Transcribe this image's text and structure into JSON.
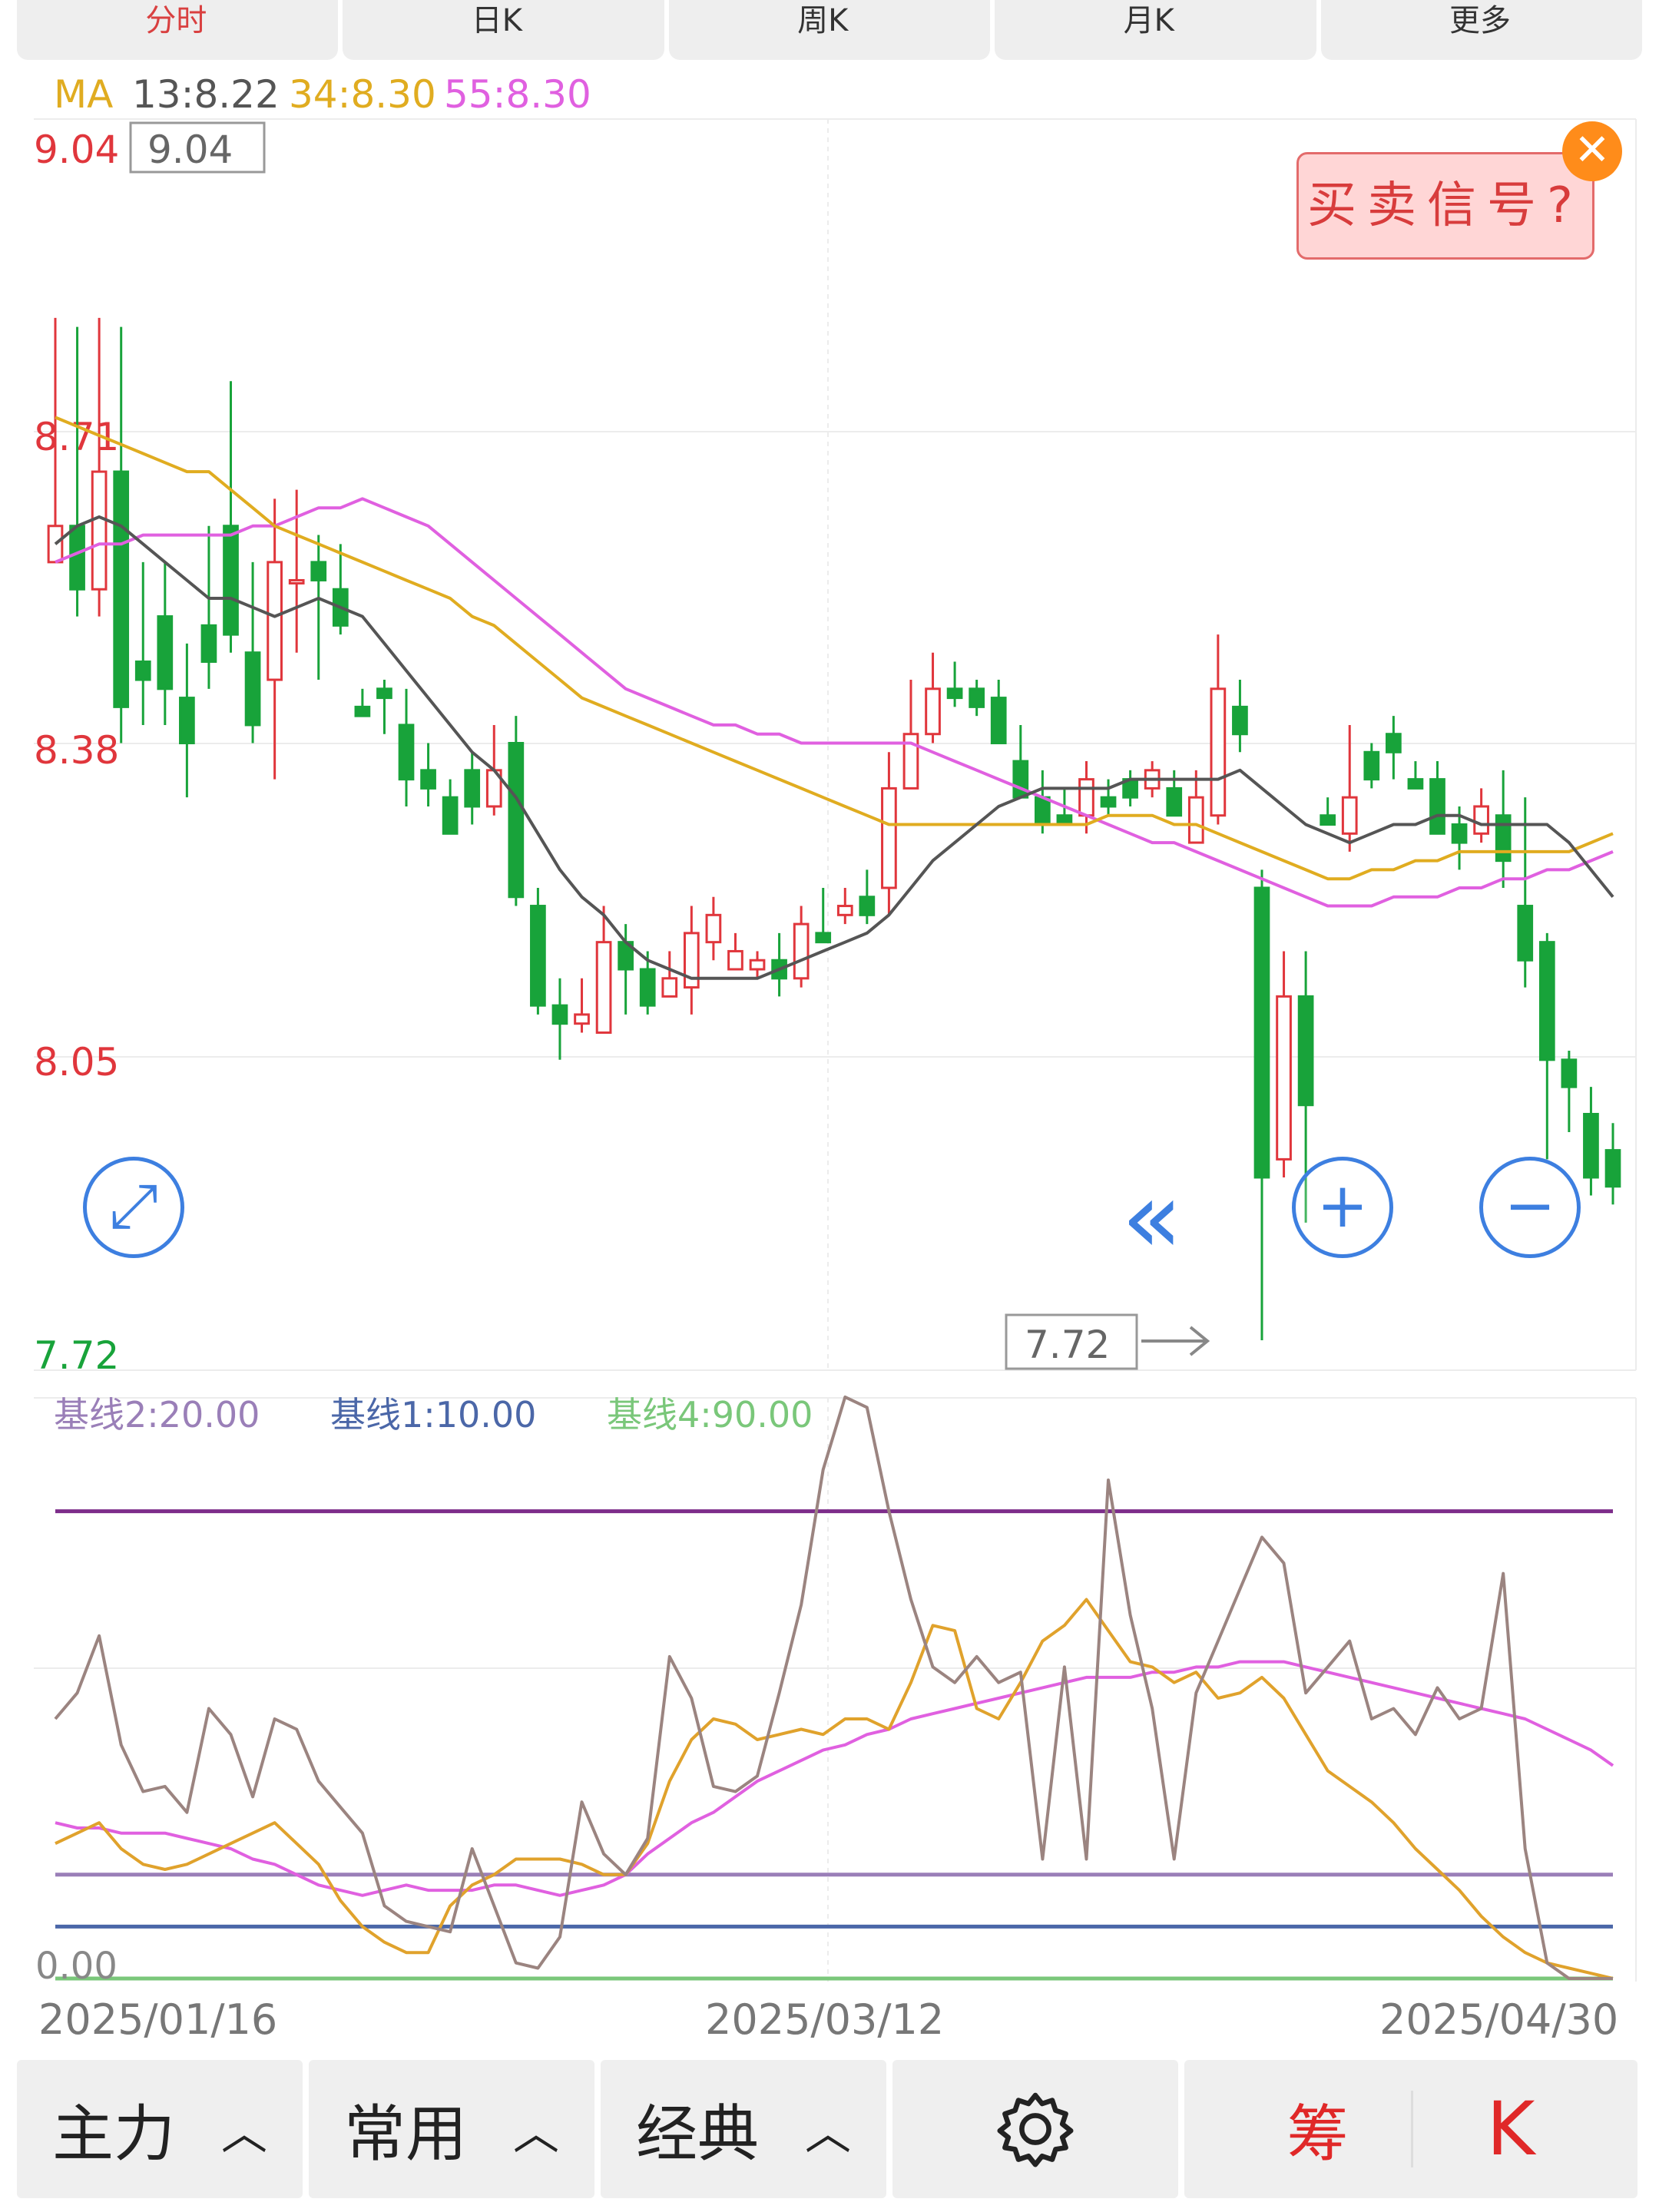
{
  "top_tabs": [
    "分时",
    "日K",
    "周K",
    "月K",
    "更多"
  ],
  "ma_legend": {
    "prefix": "MA",
    "items": [
      {
        "label": "13:8.22",
        "color": "#555555"
      },
      {
        "label": "34:8.30",
        "color": "#e0ac20"
      },
      {
        "label": "55:8.30",
        "color": "#e060e0"
      }
    ]
  },
  "price_labels": {
    "high_left": "9.04",
    "high_box": "9.04",
    "low_left": "7.72",
    "low_box": "7.72",
    "ticks": [
      "8.71",
      "8.38",
      "8.05"
    ]
  },
  "signal_button": "买卖信号?",
  "close_icon": "✕",
  "zoom_buttons": {
    "expand": "⤢",
    "plus": "+",
    "minus": "−",
    "scroll": "«"
  },
  "indicator_legend": [
    {
      "label": "基线2:20.00",
      "color": "#9a7fb8"
    },
    {
      "label": "基线1:10.00",
      "color": "#4b67a8"
    },
    {
      "label": "基线4:90.00",
      "color": "#7ac77a"
    }
  ],
  "indicator_zero": "0.00",
  "dates": [
    "2025/01/16",
    "2025/03/12",
    "2025/04/30"
  ],
  "bottom_bar": {
    "main": "主力",
    "common": "常用",
    "classic": "经典",
    "settings": "settings-icon",
    "chip": "筹",
    "k": "K"
  },
  "colors": {
    "up": "#e0363c",
    "down": "#18a33a",
    "ma13": "#555555",
    "ma34": "#e0ac20",
    "ma55": "#e060e0",
    "k_line": "#9b8480",
    "d_line": "#e0a22c",
    "j_line": "#e060e0",
    "base90": "#7d2d8a",
    "base20": "#9a7fb8",
    "base10": "#4b67a8",
    "base0": "#7ac77a"
  },
  "chart_data": {
    "type": "candlestick",
    "price_range": [
      7.72,
      9.04
    ],
    "candles": [
      [
        8.58,
        8.62,
        8.85,
        8.58
      ],
      [
        8.62,
        8.55,
        8.84,
        8.52
      ],
      [
        8.55,
        8.68,
        8.85,
        8.52
      ],
      [
        8.68,
        8.42,
        8.84,
        8.38
      ],
      [
        8.47,
        8.45,
        8.58,
        8.4
      ],
      [
        8.52,
        8.44,
        8.58,
        8.4
      ],
      [
        8.43,
        8.38,
        8.49,
        8.32
      ],
      [
        8.51,
        8.47,
        8.62,
        8.44
      ],
      [
        8.62,
        8.5,
        8.78,
        8.48
      ],
      [
        8.48,
        8.4,
        8.58,
        8.38
      ],
      [
        8.45,
        8.58,
        8.65,
        8.34
      ],
      [
        8.56,
        8.56,
        8.66,
        8.48
      ],
      [
        8.58,
        8.56,
        8.61,
        8.45
      ],
      [
        8.55,
        8.51,
        8.6,
        8.5
      ],
      [
        8.42,
        8.41,
        8.44,
        8.42
      ],
      [
        8.44,
        8.43,
        8.45,
        8.39
      ],
      [
        8.4,
        8.34,
        8.44,
        8.31
      ],
      [
        8.35,
        8.33,
        8.38,
        8.31
      ],
      [
        8.32,
        8.28,
        8.34,
        8.28
      ],
      [
        8.35,
        8.31,
        8.37,
        8.29
      ],
      [
        8.31,
        8.35,
        8.4,
        8.3
      ],
      [
        8.38,
        8.21,
        8.41,
        8.2
      ],
      [
        8.2,
        8.09,
        8.22,
        8.08
      ],
      [
        8.09,
        8.07,
        8.12,
        8.03
      ],
      [
        8.07,
        8.08,
        8.12,
        8.06
      ],
      [
        8.06,
        8.16,
        8.2,
        8.06
      ],
      [
        8.16,
        8.13,
        8.18,
        8.08
      ],
      [
        8.13,
        8.09,
        8.15,
        8.08
      ],
      [
        8.1,
        8.12,
        8.15,
        8.11
      ],
      [
        8.11,
        8.17,
        8.2,
        8.08
      ],
      [
        8.16,
        8.19,
        8.21,
        8.14
      ],
      [
        8.13,
        8.15,
        8.17,
        8.14
      ],
      [
        8.13,
        8.14,
        8.15,
        8.12
      ],
      [
        8.14,
        8.12,
        8.17,
        8.1
      ],
      [
        8.12,
        8.18,
        8.2,
        8.11
      ],
      [
        8.17,
        8.16,
        8.22,
        8.16
      ],
      [
        8.19,
        8.2,
        8.22,
        8.18
      ],
      [
        8.21,
        8.19,
        8.24,
        8.18
      ],
      [
        8.22,
        8.33,
        8.37,
        8.19
      ],
      [
        8.33,
        8.39,
        8.45,
        8.35
      ],
      [
        8.39,
        8.44,
        8.48,
        8.38
      ],
      [
        8.44,
        8.43,
        8.47,
        8.42
      ],
      [
        8.44,
        8.42,
        8.45,
        8.41
      ],
      [
        8.43,
        8.38,
        8.45,
        8.38
      ],
      [
        8.36,
        8.32,
        8.4,
        8.32
      ],
      [
        8.32,
        8.29,
        8.35,
        8.28
      ],
      [
        8.3,
        8.29,
        8.33,
        8.3
      ],
      [
        8.3,
        8.34,
        8.36,
        8.28
      ],
      [
        8.32,
        8.31,
        8.34,
        8.3
      ],
      [
        8.34,
        8.32,
        8.35,
        8.31
      ],
      [
        8.33,
        8.35,
        8.36,
        8.32
      ],
      [
        8.33,
        8.3,
        8.35,
        8.3
      ],
      [
        8.27,
        8.32,
        8.35,
        8.27
      ],
      [
        8.3,
        8.44,
        8.5,
        8.29
      ],
      [
        8.42,
        8.39,
        8.45,
        8.37
      ],
      [
        8.22,
        7.9,
        8.24,
        7.72
      ],
      [
        7.92,
        8.1,
        8.15,
        7.9
      ],
      [
        8.1,
        7.98,
        8.15,
        7.85
      ],
      [
        8.3,
        8.29,
        8.32,
        8.29
      ],
      [
        8.28,
        8.32,
        8.4,
        8.26
      ],
      [
        8.37,
        8.34,
        8.38,
        8.33
      ],
      [
        8.39,
        8.37,
        8.41,
        8.34
      ],
      [
        8.34,
        8.33,
        8.36,
        8.33
      ],
      [
        8.34,
        8.28,
        8.36,
        8.28
      ],
      [
        8.29,
        8.27,
        8.31,
        8.24
      ],
      [
        8.28,
        8.31,
        8.33,
        8.27
      ],
      [
        8.3,
        8.25,
        8.35,
        8.22
      ],
      [
        8.2,
        8.14,
        8.32,
        8.11
      ],
      [
        8.16,
        8.03,
        8.17,
        7.92
      ],
      [
        8.03,
        8.0,
        8.04,
        7.95
      ],
      [
        7.97,
        7.9,
        8.0,
        7.88
      ],
      [
        7.93,
        7.89,
        7.96,
        7.87
      ]
    ],
    "ma13": [
      8.6,
      8.62,
      8.63,
      8.62,
      8.6,
      8.58,
      8.56,
      8.54,
      8.54,
      8.53,
      8.52,
      8.53,
      8.54,
      8.53,
      8.52,
      8.49,
      8.46,
      8.43,
      8.4,
      8.37,
      8.35,
      8.32,
      8.28,
      8.24,
      8.21,
      8.19,
      8.16,
      8.14,
      8.13,
      8.12,
      8.12,
      8.12,
      8.12,
      8.13,
      8.14,
      8.15,
      8.16,
      8.17,
      8.19,
      8.22,
      8.25,
      8.27,
      8.29,
      8.31,
      8.32,
      8.33,
      8.33,
      8.33,
      8.33,
      8.34,
      8.34,
      8.34,
      8.34,
      8.34,
      8.35,
      8.33,
      8.31,
      8.29,
      8.28,
      8.27,
      8.28,
      8.29,
      8.29,
      8.3,
      8.3,
      8.29,
      8.29,
      8.29,
      8.29,
      8.27,
      8.24,
      8.21
    ],
    "ma34": [
      8.74,
      8.73,
      8.72,
      8.71,
      8.7,
      8.69,
      8.68,
      8.68,
      8.66,
      8.64,
      8.62,
      8.61,
      8.6,
      8.59,
      8.58,
      8.57,
      8.56,
      8.55,
      8.54,
      8.52,
      8.51,
      8.49,
      8.47,
      8.45,
      8.43,
      8.42,
      8.41,
      8.4,
      8.39,
      8.38,
      8.37,
      8.36,
      8.35,
      8.34,
      8.33,
      8.32,
      8.31,
      8.3,
      8.29,
      8.29,
      8.29,
      8.29,
      8.29,
      8.29,
      8.29,
      8.29,
      8.29,
      8.29,
      8.3,
      8.3,
      8.3,
      8.29,
      8.29,
      8.28,
      8.27,
      8.26,
      8.25,
      8.24,
      8.23,
      8.23,
      8.24,
      8.24,
      8.25,
      8.25,
      8.26,
      8.26,
      8.26,
      8.26,
      8.26,
      8.26,
      8.27,
      8.28
    ],
    "ma55": [
      8.58,
      8.59,
      8.6,
      8.6,
      8.61,
      8.61,
      8.61,
      8.61,
      8.61,
      8.62,
      8.62,
      8.63,
      8.64,
      8.64,
      8.65,
      8.64,
      8.63,
      8.62,
      8.6,
      8.58,
      8.56,
      8.54,
      8.52,
      8.5,
      8.48,
      8.46,
      8.44,
      8.43,
      8.42,
      8.41,
      8.4,
      8.4,
      8.39,
      8.39,
      8.38,
      8.38,
      8.38,
      8.38,
      8.38,
      8.38,
      8.37,
      8.36,
      8.35,
      8.34,
      8.33,
      8.32,
      8.31,
      8.3,
      8.29,
      8.28,
      8.27,
      8.27,
      8.26,
      8.25,
      8.24,
      8.23,
      8.22,
      8.21,
      8.2,
      8.2,
      8.2,
      8.21,
      8.21,
      8.21,
      8.22,
      8.22,
      8.23,
      8.23,
      8.24,
      8.24,
      8.25,
      8.26
    ],
    "indicator": {
      "range": [
        0,
        100
      ],
      "k": [
        50,
        55,
        66,
        45,
        36,
        37,
        32,
        52,
        47,
        35,
        50,
        48,
        38,
        33,
        28,
        14,
        11,
        10,
        9,
        25,
        14,
        3,
        2,
        8,
        34,
        24,
        20,
        27,
        62,
        54,
        37,
        36,
        39,
        55,
        72,
        98,
        120,
        110,
        90,
        73,
        60,
        57,
        62,
        57,
        59,
        23,
        60,
        23,
        96,
        70,
        52,
        23,
        55,
        65,
        75,
        85,
        80,
        55,
        60,
        65,
        50,
        52,
        47,
        56,
        50,
        52,
        78,
        25,
        3,
        0,
        0,
        0
      ],
      "d": [
        26,
        28,
        30,
        25,
        22,
        21,
        22,
        24,
        26,
        28,
        30,
        26,
        22,
        15,
        10,
        7,
        5,
        5,
        14,
        18,
        20,
        23,
        23,
        23,
        22,
        20,
        20,
        26,
        38,
        46,
        50,
        49,
        46,
        47,
        48,
        47,
        50,
        50,
        48,
        57,
        68,
        67,
        52,
        50,
        57,
        65,
        68,
        73,
        67,
        61,
        60,
        57,
        59,
        54,
        55,
        58,
        54,
        47,
        40,
        37,
        34,
        30,
        25,
        21,
        17,
        12,
        8,
        5,
        3,
        2,
        1,
        0
      ],
      "j": [
        30,
        29,
        29,
        28,
        28,
        28,
        27,
        26,
        25,
        23,
        22,
        20,
        18,
        17,
        16,
        17,
        18,
        17,
        17,
        17,
        18,
        18,
        17,
        16,
        17,
        18,
        20,
        24,
        27,
        30,
        32,
        35,
        38,
        40,
        42,
        44,
        45,
        47,
        48,
        50,
        51,
        52,
        53,
        54,
        55,
        56,
        57,
        58,
        58,
        58,
        59,
        59,
        60,
        60,
        61,
        61,
        61,
        60,
        59,
        58,
        57,
        56,
        55,
        54,
        53,
        52,
        51,
        50,
        48,
        46,
        44,
        41
      ]
    },
    "base_lines": [
      90,
      20,
      10,
      0
    ]
  }
}
